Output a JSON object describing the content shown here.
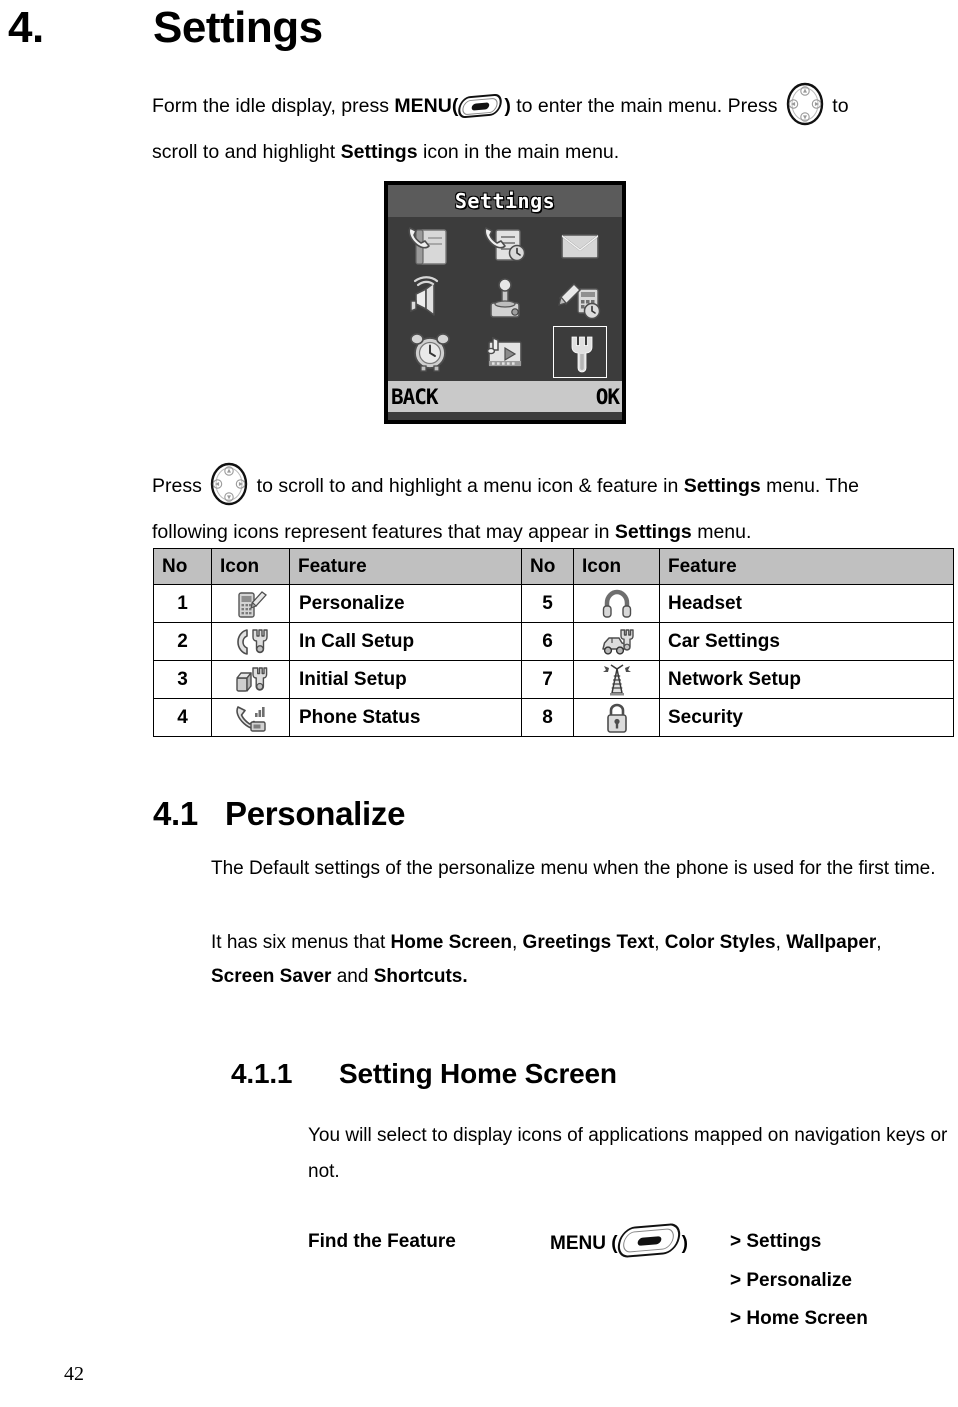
{
  "chapter": {
    "number": "4.",
    "title": "Settings"
  },
  "intro": {
    "part1": "Form the idle display, press ",
    "menu_label": "MENU",
    "paren_open": "(",
    "paren_close": ")",
    "part2": " to enter the main menu. Press ",
    "part3": " to",
    "line2_part1": "scroll to and highlight ",
    "line2_bold": "Settings",
    "line2_part2": " icon in the main menu."
  },
  "phone_screen": {
    "title": "Settings",
    "softkey_left": "BACK",
    "softkey_right": "OK",
    "icons": [
      {
        "name": "phonebook-icon",
        "label": "Phonebook",
        "selected": false
      },
      {
        "name": "recent-calls-icon",
        "label": "Recent Calls",
        "selected": false
      },
      {
        "name": "messages-icon",
        "label": "Messages",
        "selected": false
      },
      {
        "name": "ring-styles-icon",
        "label": "Ring Styles",
        "selected": false
      },
      {
        "name": "games-icon",
        "label": "Games",
        "selected": false
      },
      {
        "name": "office-tools-icon",
        "label": "Office Tools",
        "selected": false
      },
      {
        "name": "alarm-clock-icon",
        "label": "Alarm Clock",
        "selected": false
      },
      {
        "name": "multimedia-icon",
        "label": "Multimedia",
        "selected": false
      },
      {
        "name": "settings-wrench-icon",
        "label": "Settings",
        "selected": true
      }
    ]
  },
  "press_para": {
    "part1": "Press ",
    "part2": " to scroll to and highlight a menu icon & feature in ",
    "bold1": "Settings",
    "part3": " menu. The",
    "line2_part1": "following icons represent features that may appear in ",
    "line2_bold": "Settings",
    "line2_part2": " menu."
  },
  "table": {
    "headers": [
      "No",
      "Icon",
      "Feature",
      "No",
      "Icon",
      "Feature"
    ],
    "rows": [
      {
        "no_l": "1",
        "icon_l": "personalize-icon",
        "feature_l": "Personalize",
        "no_r": "5",
        "icon_r": "headset-icon",
        "feature_r": "Headset"
      },
      {
        "no_l": "2",
        "icon_l": "in-call-setup-icon",
        "feature_l": "In Call Setup",
        "no_r": "6",
        "icon_r": "car-settings-icon",
        "feature_r": "Car Settings"
      },
      {
        "no_l": "3",
        "icon_l": "initial-setup-icon",
        "feature_l": "Initial Setup",
        "no_r": "7",
        "icon_r": "network-setup-icon",
        "feature_r": "Network Setup"
      },
      {
        "no_l": "4",
        "icon_l": "phone-status-icon",
        "feature_l": "Phone Status",
        "no_r": "8",
        "icon_r": "security-icon",
        "feature_r": "Security"
      }
    ]
  },
  "section_41": {
    "number": "4.1",
    "title": "Personalize",
    "para1": "The Default settings of the personalize menu when the phone is used for the first time.",
    "para2_prefix": "It has six menus that ",
    "menus": [
      "Home Screen",
      "Greetings Text",
      "Color Styles",
      "Wallpaper",
      "Screen Saver",
      "Shortcuts."
    ],
    "para2_and": " and "
  },
  "section_411": {
    "number": "4.1.1",
    "title": "Setting Home Screen",
    "para": "You will select to display icons of applications mapped on navigation keys or not."
  },
  "find_feature": {
    "label": "Find the Feature",
    "menu_label": "MENU",
    "paren_open": "(",
    "paren_close": ")",
    "path1": "> Settings",
    "path2": "> Personalize",
    "path3": "> Home Screen"
  },
  "footer": {
    "page_number": "42"
  },
  "colors": {
    "table_header_bg": "#c0c0c0",
    "screen_body_bg": "#3c3c3c",
    "screen_title_bg": "#5b5b5b",
    "screen_soft_bg": "#c9c9c9",
    "text": "#000000"
  }
}
